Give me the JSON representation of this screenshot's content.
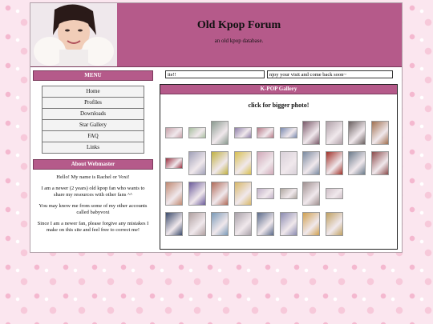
{
  "header": {
    "title": "Old Kpop Forum",
    "subtitle": "an old kpop database."
  },
  "menu": {
    "heading": "MENU",
    "items": [
      "Home",
      "Profiles",
      "Downloads",
      "Star Gallery",
      "FAQ",
      "Links"
    ]
  },
  "about": {
    "heading": "About Webmaster",
    "paragraphs": [
      "Hello! My name is Rachel or Voxi!",
      "I am a newer (2 years) old kpop fan who wants to share my resources with other fans ^^",
      "You may know me from some of my other accounts called babyvoxi",
      "Since I am a newer fan, please forgive any mistakes I make on this site and feel free to correct me!"
    ]
  },
  "tickers": {
    "left": "ite!!",
    "right": "njoy your visit and come back soon~"
  },
  "gallery": {
    "heading": "K-POP Gallery",
    "note": "click for bigger photo!"
  },
  "colors": {
    "accent": "#b55a8a",
    "background": "#fbe6ef"
  }
}
